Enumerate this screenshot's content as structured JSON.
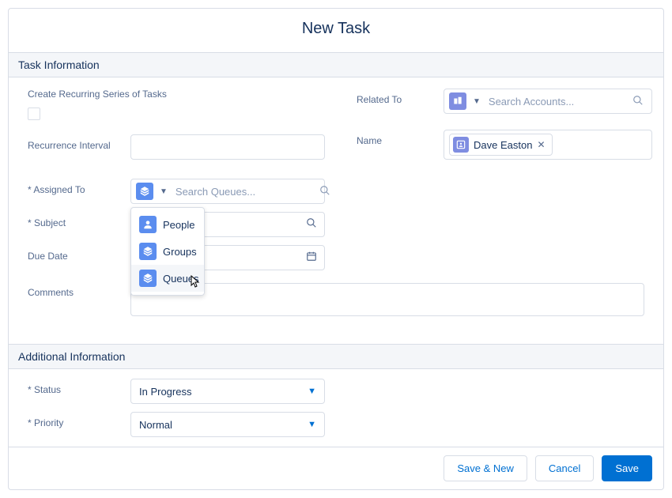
{
  "modal": {
    "title": "New Task"
  },
  "sections": {
    "task_info": "Task Information",
    "additional": "Additional Information"
  },
  "labels": {
    "recurring": "Create Recurring Series of Tasks",
    "recurrence_interval": "Recurrence Interval",
    "assigned_to": "* Assigned To",
    "subject": "* Subject",
    "due_date": "Due Date",
    "comments": "Comments",
    "related_to": "Related To",
    "name": "Name",
    "status": "* Status",
    "priority": "* Priority"
  },
  "placeholders": {
    "search_accounts": "Search Accounts...",
    "search_queues": "Search Queues..."
  },
  "values": {
    "name_pill": "Dave Easton",
    "status": "In Progress",
    "priority": "Normal"
  },
  "dropdown": {
    "people": "People",
    "groups": "Groups",
    "queues": "Queues"
  },
  "icons": {
    "account": "account-icon",
    "layers": "layers-icon",
    "person": "person-icon",
    "contact": "contact-icon"
  },
  "footer": {
    "save_new": "Save & New",
    "cancel": "Cancel",
    "save": "Save"
  }
}
